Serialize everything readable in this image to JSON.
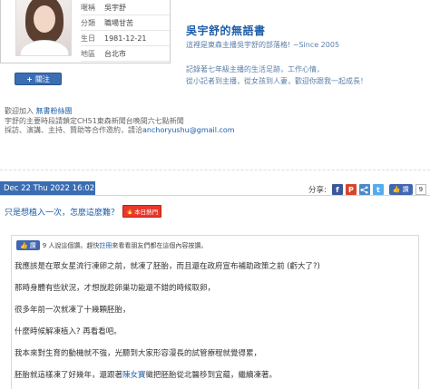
{
  "profile": {
    "rows": [
      {
        "key": "暱稱",
        "value": "吳宇舒"
      },
      {
        "key": "分類",
        "value": "職場甘苦"
      },
      {
        "key": "生日",
        "value": "1981-12-21"
      },
      {
        "key": "地區",
        "value": "台北市"
      }
    ],
    "follow_label": "關注"
  },
  "blog": {
    "title": "吳宇舒的無語書",
    "subtitle": "這裡是東森主播吳宇舒的部落格! ~Since 2005",
    "desc_line1": "記錄著七年級主播的生活足跡，工作心情，",
    "desc_line2": "從小記者到主播，從女孩到人妻，歡迎你跟我一起成長！"
  },
  "welcome": {
    "prefix": "歡迎加入",
    "link": "無書粉絲團",
    "line2": "宇舒的主要時段請鎖定CH51東森新聞台晚間六七點新聞",
    "line3_prefix": "採訪、演講、主持、贊助等合作邀約，請洽",
    "email": "anchoryushu@gmail.com"
  },
  "post": {
    "date": "Dec 22 Thu 2022 16:02",
    "share_label": "分享:",
    "like_label": "讚",
    "like_count": "9",
    "title": "只是想植入一次，怎麼這麼難？",
    "hot_badge": "本日熱門",
    "likes_text_prefix": "9 人說這個讚。趕快",
    "likes_link": "註冊",
    "likes_text_suffix": "來看看朋友們都在這個內容按讚。",
    "paragraphs": [
      {
        "pre": "我應該是在眾女星流行凍卵之前，就凍了胚胎，而且還在政府宣布補助政策之前 (虧大了?)",
        "hl": "",
        "post": ""
      },
      {
        "pre": "那時身體有些狀況，才想說趁卵巢功能還不錯的時候取卵，",
        "hl": "",
        "post": ""
      },
      {
        "pre": "很多年前一次就凍了十幾顆胚胎，",
        "hl": "",
        "post": ""
      },
      {
        "pre": "什麼時候解凍植入? 再看看吧。",
        "hl": "",
        "post": ""
      },
      {
        "pre": "我本來對生育的動機就不強，光聽到大家形容漫長的試管療程就覺得累，",
        "hl": "",
        "post": ""
      },
      {
        "pre": "胚胎就這樣凍了好幾年，還跟著",
        "hl": "陳女寶",
        "post": "徵把胚胎從北醫移到宜蘊，繼續凍著。"
      }
    ]
  },
  "colors": {
    "accent": "#3a6db2",
    "link": "#1f5ea8",
    "hot": "#e8382c",
    "facebook": "#4267b2"
  },
  "icons": {
    "facebook": "f",
    "plurk": "P",
    "share": "share",
    "twitter": "t"
  }
}
